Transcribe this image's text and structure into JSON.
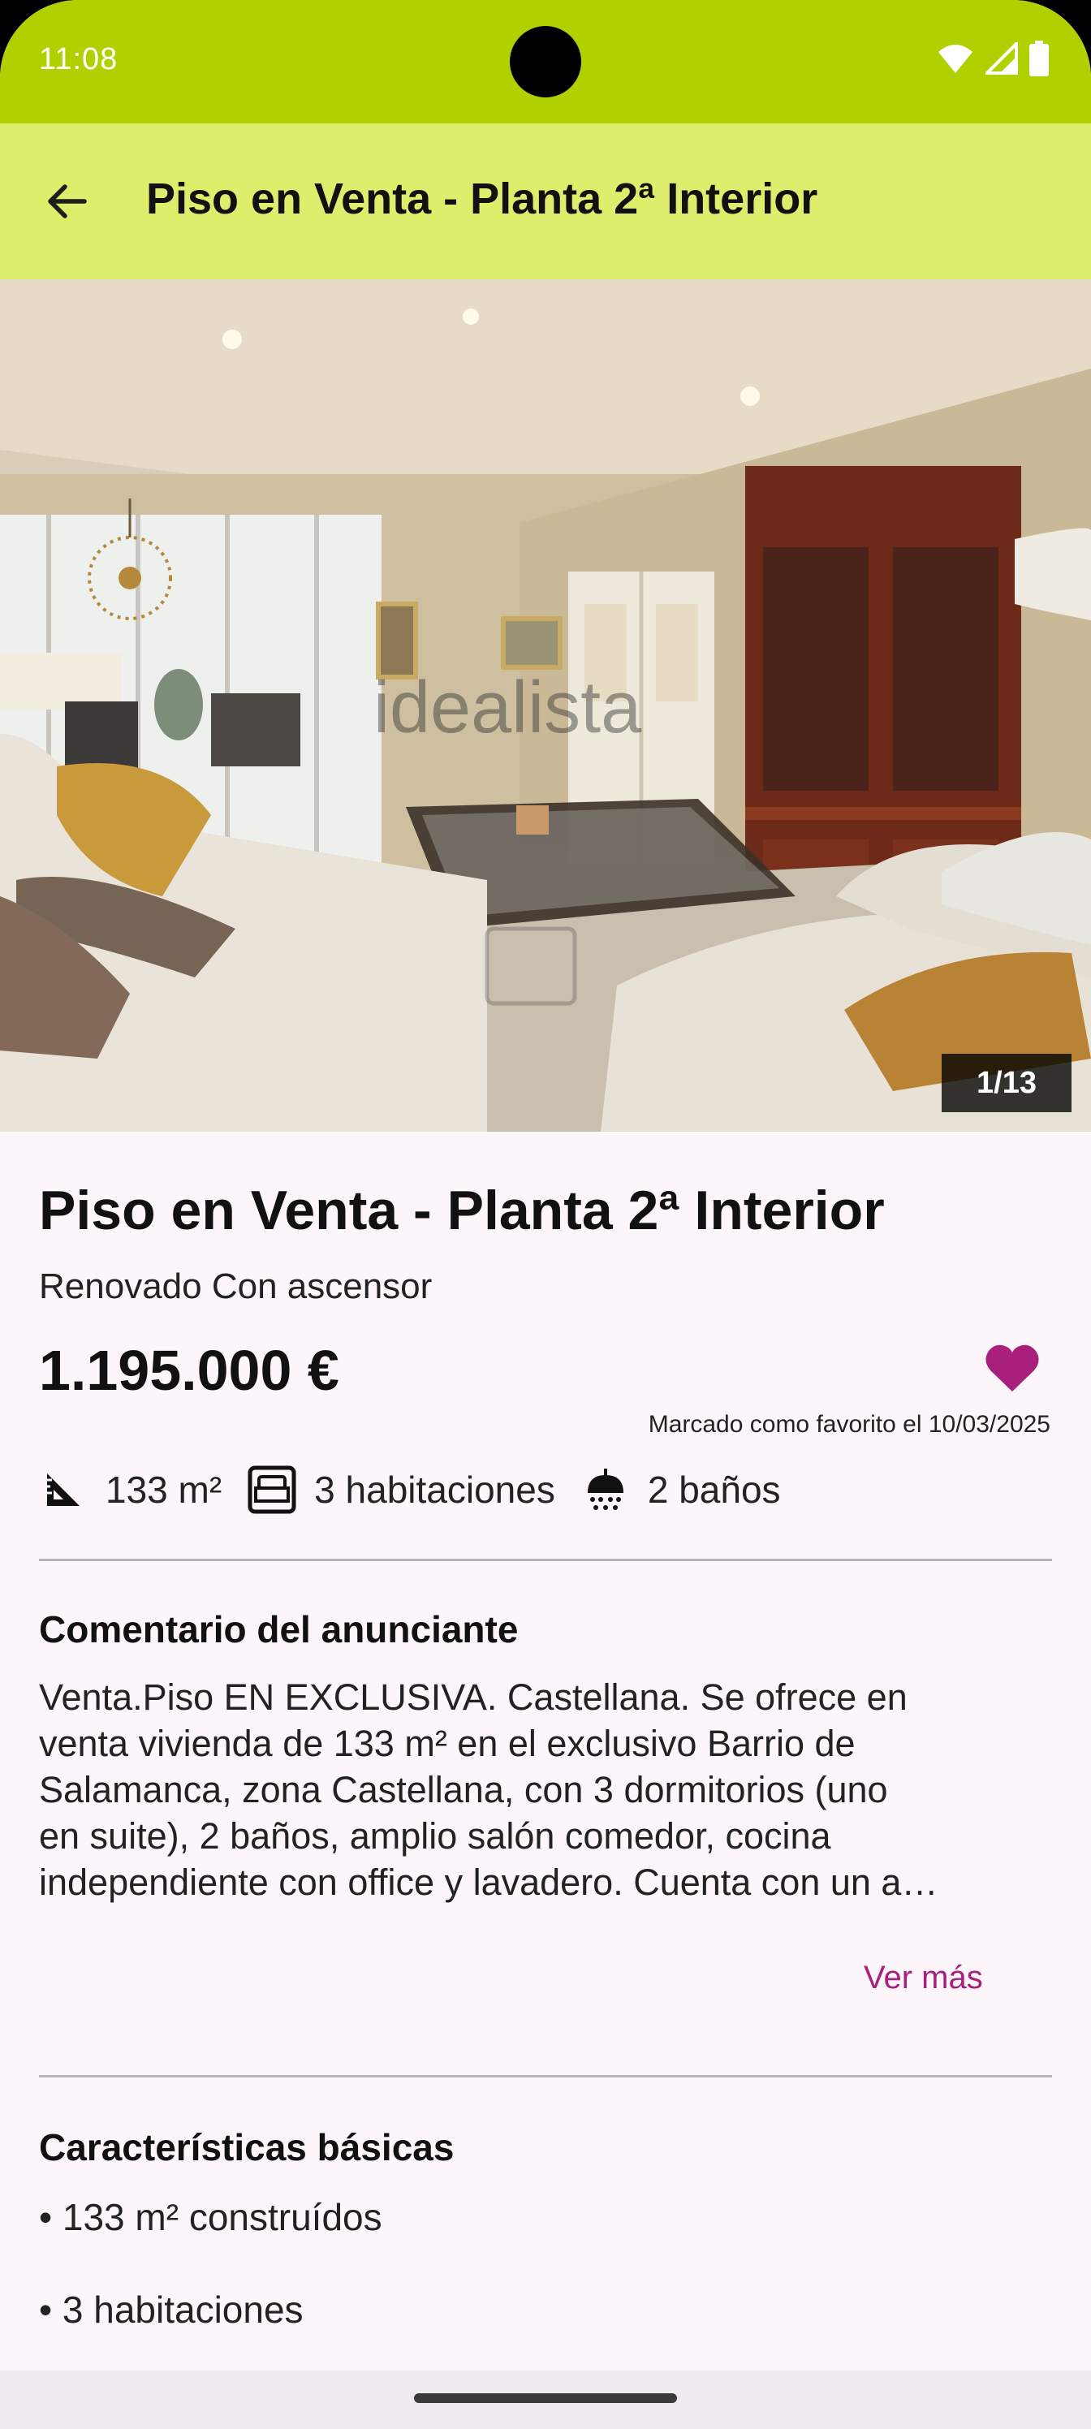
{
  "status_bar": {
    "time": "11:08"
  },
  "app_bar": {
    "title": "Piso en Venta - Planta 2ª Interior"
  },
  "gallery": {
    "counter": "1/13",
    "watermark": "idealista"
  },
  "listing": {
    "title": "Piso en Venta - Planta 2ª Interior",
    "subtitle": "Renovado Con ascensor",
    "price": "1.195.000 €",
    "favorite_text": "Marcado como favorito el 10/03/2025",
    "features": {
      "area": "133 m²",
      "rooms": "3 habitaciones",
      "baths": "2 baños"
    }
  },
  "comment": {
    "heading": "Comentario del anunciante",
    "lines": [
      "Venta.Piso EN EXCLUSIVA. Castellana. Se ofrece en",
      "venta vivienda de 133 m² en el exclusivo Barrio de",
      "Salamanca, zona Castellana, con 3 dormitorios (uno",
      "en suite), 2 baños, amplio salón comedor, cocina",
      "independiente con office y lavadero. Cuenta con un a…"
    ],
    "more_label": "Ver más"
  },
  "basic_features": {
    "heading": "Características básicas",
    "items": [
      "• 133 m² construídos",
      "• 3 habitaciones"
    ]
  },
  "colors": {
    "status_bar": "#b0d000",
    "app_bar": "#dcee6b",
    "accent": "#a8207c",
    "background": "#fcf6fb"
  },
  "icons": {
    "back": "arrow-left-icon",
    "favorite": "heart-icon",
    "area": "ruler-triangle-icon",
    "rooms": "bed-icon",
    "baths": "shower-icon",
    "wifi": "wifi-icon",
    "signal": "signal-icon",
    "battery": "battery-icon"
  }
}
